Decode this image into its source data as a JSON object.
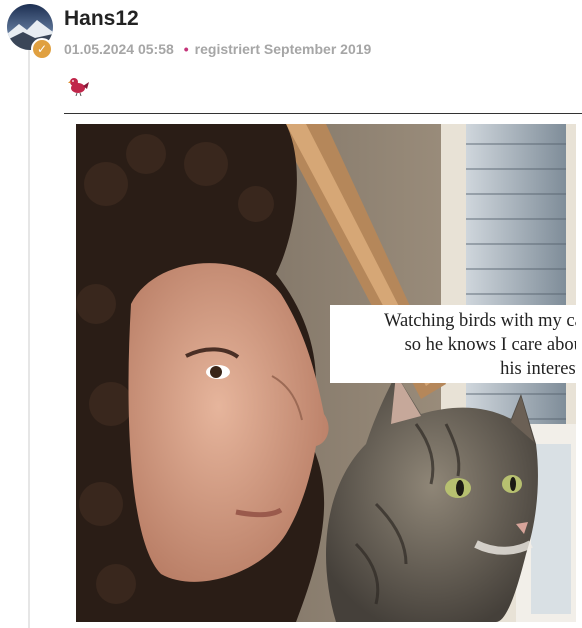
{
  "post": {
    "username": "Hans12",
    "timestamp": "01.05.2024 05:58",
    "separator": "•",
    "registered": "registriert September 2019",
    "reaction_icon": "bird-icon",
    "verified_badge": "✓",
    "meme": {
      "caption_lines": [
        "Watching birds with my cat",
        "so he knows I care about",
        "his interests"
      ]
    }
  },
  "colors": {
    "badge": "#e0a040",
    "dot": "#c4357a",
    "bird": "#c0264a"
  }
}
